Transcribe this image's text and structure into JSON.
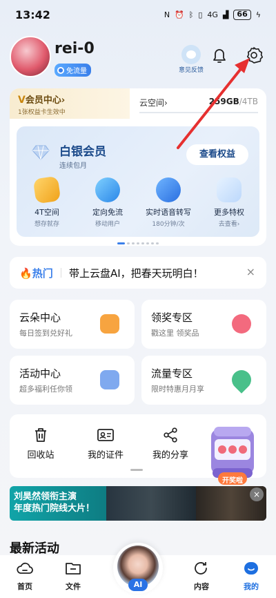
{
  "status": {
    "time": "13:42",
    "battery": "66",
    "signal": "4G"
  },
  "profile": {
    "username": "rei-0",
    "badge": "免流量",
    "feedback_label": "意见反馈"
  },
  "vip": {
    "prefix": "V",
    "title": "会员中心",
    "chevron": "›",
    "subtitle": "1张权益卡生效中"
  },
  "cloud": {
    "label": "云空间",
    "chevron": "›",
    "used": "259GB",
    "total": "/4TB"
  },
  "membership": {
    "title": "白银会员",
    "subtitle": "连续包月",
    "button": "查看权益",
    "perks": [
      {
        "label": "4T空间",
        "sub": "想存就存",
        "icon": "storage-icon"
      },
      {
        "label": "定向免流",
        "sub": "移动用户",
        "icon": "free-traffic-icon"
      },
      {
        "label": "实时语音转写",
        "sub": "180分钟/次",
        "icon": "voice-transcribe-icon"
      },
      {
        "label": "更多特权",
        "sub": "去查看›",
        "icon": "more-privileges-icon"
      }
    ]
  },
  "hot": {
    "label": "热门",
    "text": "带上云盘AI，把春天玩明白！",
    "close": "×"
  },
  "tiles": [
    {
      "title": "云朵中心",
      "sub": "每日签到兑好礼",
      "icon": "calendar-icon",
      "color": "#f7a440"
    },
    {
      "title": "领奖专区",
      "sub": "戳这里 领奖品",
      "icon": "gift-icon",
      "color": "#f36a7e"
    },
    {
      "title": "活动中心",
      "sub": "超多福利任你领",
      "icon": "activity-icon",
      "color": "#7fa9ef"
    },
    {
      "title": "流量专区",
      "sub": "限时特惠月月享",
      "icon": "traffic-icon",
      "color": "#49c08a"
    }
  ],
  "tools": [
    {
      "label": "回收站",
      "icon": "trash-icon"
    },
    {
      "label": "我的证件",
      "icon": "id-card-icon"
    },
    {
      "label": "我的分享",
      "icon": "share-icon"
    }
  ],
  "machine": {
    "button": "开奖啦"
  },
  "ad": {
    "line1": "刘昊然领衔主演",
    "line2": "年度热门院线大片！",
    "close": "×"
  },
  "latest": {
    "title": "最新活动"
  },
  "tabs": [
    {
      "label": "首页",
      "icon": "home-cloud-icon"
    },
    {
      "label": "文件",
      "icon": "folder-icon"
    },
    {
      "label": "AI",
      "icon": "ai-avatar-icon"
    },
    {
      "label": "内容",
      "icon": "content-icon"
    },
    {
      "label": "我的",
      "icon": "profile-icon"
    }
  ],
  "colors": {
    "accent": "#1e6fe0",
    "gold": "#c9860e",
    "annotation_arrow": "#e63030"
  }
}
